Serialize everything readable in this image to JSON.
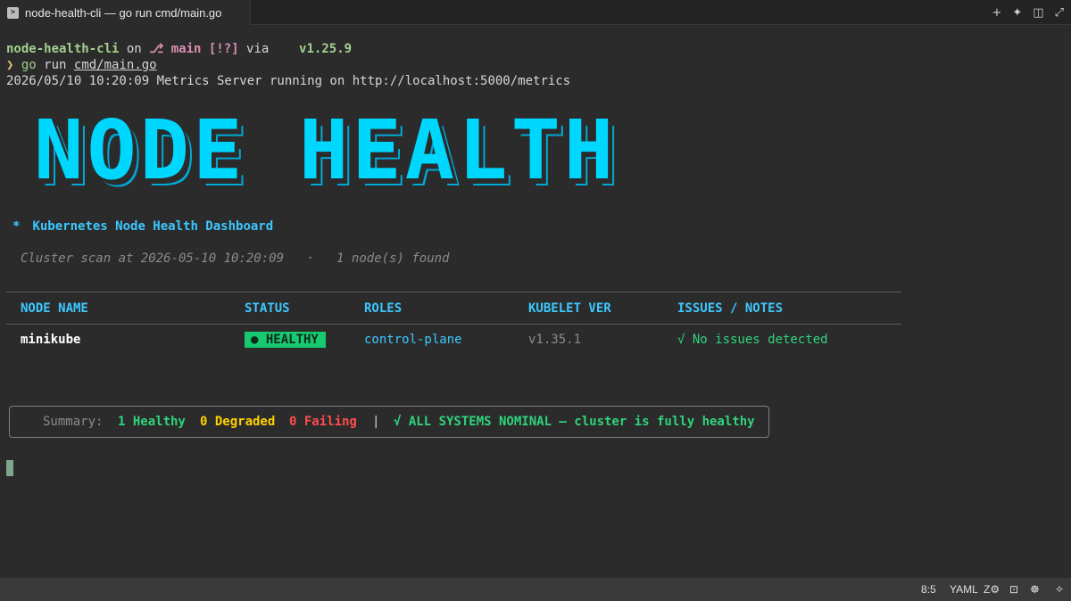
{
  "tab": {
    "icon": "terminal-icon",
    "title": "node-health-cli — go run cmd/main.go"
  },
  "tab_actions": [
    {
      "name": "add-tab-icon",
      "glyph": "+"
    },
    {
      "name": "ai-sparkle-icon",
      "glyph": "✦"
    },
    {
      "name": "split-pane-icon",
      "glyph": "◫"
    },
    {
      "name": "expand-icon",
      "glyph": "⤢"
    }
  ],
  "prompt": {
    "dir": "node-health-cli",
    "on": " on ",
    "branch_icon": "",
    "branch": "main",
    "status": "[!?]",
    "via": " via ",
    "go_icon": "",
    "go_version": "v1.25.9"
  },
  "command": {
    "chevron": "❯",
    "go": "go",
    "run": " run ",
    "path": "cmd/main.go"
  },
  "log_line": "2026/05/10 10:20:09 Metrics Server running on http://localhost:5000/metrics",
  "banner": "NODE HEALTH",
  "subtitle": {
    "star": "*",
    "text": "Kubernetes Node Health Dashboard"
  },
  "scan": {
    "text": "Cluster scan at 2026-05-10 10:20:09",
    "sep": "·",
    "count": "1 node(s) found"
  },
  "table": {
    "headers": [
      "NODE NAME",
      "STATUS",
      "ROLES",
      "KUBELET VER",
      "ISSUES / NOTES"
    ],
    "rows": [
      {
        "name": "minikube",
        "status": "● HEALTHY",
        "roles": "control-plane",
        "kubelet": "v1.35.1",
        "issues": "√ No issues detected"
      }
    ]
  },
  "summary": {
    "label": "Summary:",
    "healthy": "1 Healthy",
    "degraded": "0 Degraded",
    "failing": "0 Failing",
    "separator": "|",
    "nominal": "√ ALL SYSTEMS NOMINAL — cluster is fully healthy"
  },
  "statusbar": {
    "position": "8:5",
    "language": "YAML",
    "icons": [
      "translate-icon",
      "terminal-panel-icon",
      "bug-icon",
      "sparkle-icon"
    ]
  },
  "colors": {
    "accent": "#00d7ff",
    "healthy": "#2fd47c",
    "degraded": "#ffd000",
    "failing": "#ff4d4d"
  }
}
